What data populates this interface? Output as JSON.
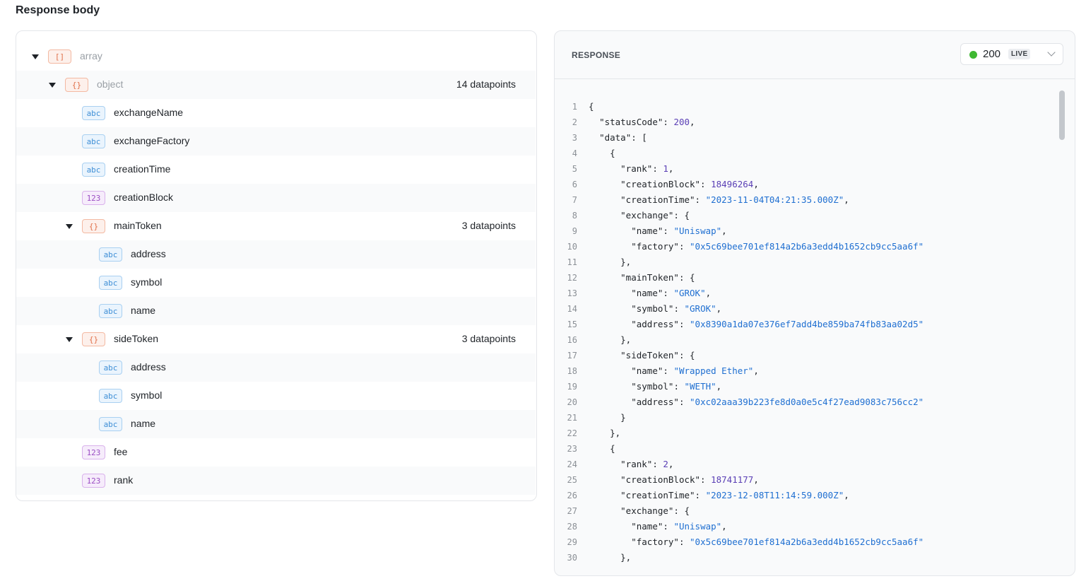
{
  "page": {
    "title": "Response body"
  },
  "schema": {
    "rows": [
      {
        "type": "array",
        "badge": "[]",
        "name": "array",
        "depth": 0,
        "caret": true,
        "count": ""
      },
      {
        "type": "object",
        "badge": "{}",
        "name": "object",
        "depth": 1,
        "caret": true,
        "count": "14 datapoints"
      },
      {
        "type": "string",
        "badge": "abc",
        "name": "exchangeName",
        "depth": 2,
        "caret": false,
        "count": ""
      },
      {
        "type": "string",
        "badge": "abc",
        "name": "exchangeFactory",
        "depth": 2,
        "caret": false,
        "count": ""
      },
      {
        "type": "string",
        "badge": "abc",
        "name": "creationTime",
        "depth": 2,
        "caret": false,
        "count": ""
      },
      {
        "type": "number",
        "badge": "123",
        "name": "creationBlock",
        "depth": 2,
        "caret": false,
        "count": ""
      },
      {
        "type": "object",
        "badge": "{}",
        "name": "mainToken",
        "depth": 2,
        "caret": true,
        "count": "3 datapoints"
      },
      {
        "type": "string",
        "badge": "abc",
        "name": "address",
        "depth": 3,
        "caret": false,
        "count": ""
      },
      {
        "type": "string",
        "badge": "abc",
        "name": "symbol",
        "depth": 3,
        "caret": false,
        "count": ""
      },
      {
        "type": "string",
        "badge": "abc",
        "name": "name",
        "depth": 3,
        "caret": false,
        "count": ""
      },
      {
        "type": "object",
        "badge": "{}",
        "name": "sideToken",
        "depth": 2,
        "caret": true,
        "count": "3 datapoints"
      },
      {
        "type": "string",
        "badge": "abc",
        "name": "address",
        "depth": 3,
        "caret": false,
        "count": ""
      },
      {
        "type": "string",
        "badge": "abc",
        "name": "symbol",
        "depth": 3,
        "caret": false,
        "count": ""
      },
      {
        "type": "string",
        "badge": "abc",
        "name": "name",
        "depth": 3,
        "caret": false,
        "count": ""
      },
      {
        "type": "number",
        "badge": "123",
        "name": "fee",
        "depth": 2,
        "caret": false,
        "count": ""
      },
      {
        "type": "number",
        "badge": "123",
        "name": "rank",
        "depth": 2,
        "caret": false,
        "count": ""
      }
    ]
  },
  "response": {
    "label": "RESPONSE",
    "status_code": "200",
    "status_tag": "LIVE",
    "status_color": "#3fb832",
    "lines": [
      [
        [
          "p",
          "{"
        ]
      ],
      [
        [
          "p",
          "  "
        ],
        [
          "k",
          "\"statusCode\""
        ],
        [
          "p",
          ": "
        ],
        [
          "n",
          "200"
        ],
        [
          "p",
          ","
        ]
      ],
      [
        [
          "p",
          "  "
        ],
        [
          "k",
          "\"data\""
        ],
        [
          "p",
          ": ["
        ]
      ],
      [
        [
          "p",
          "    {"
        ]
      ],
      [
        [
          "p",
          "      "
        ],
        [
          "k",
          "\"rank\""
        ],
        [
          "p",
          ": "
        ],
        [
          "n",
          "1"
        ],
        [
          "p",
          ","
        ]
      ],
      [
        [
          "p",
          "      "
        ],
        [
          "k",
          "\"creationBlock\""
        ],
        [
          "p",
          ": "
        ],
        [
          "n",
          "18496264"
        ],
        [
          "p",
          ","
        ]
      ],
      [
        [
          "p",
          "      "
        ],
        [
          "k",
          "\"creationTime\""
        ],
        [
          "p",
          ": "
        ],
        [
          "s",
          "\"2023-11-04T04:21:35.000Z\""
        ],
        [
          "p",
          ","
        ]
      ],
      [
        [
          "p",
          "      "
        ],
        [
          "k",
          "\"exchange\""
        ],
        [
          "p",
          ": {"
        ]
      ],
      [
        [
          "p",
          "        "
        ],
        [
          "k",
          "\"name\""
        ],
        [
          "p",
          ": "
        ],
        [
          "s",
          "\"Uniswap\""
        ],
        [
          "p",
          ","
        ]
      ],
      [
        [
          "p",
          "        "
        ],
        [
          "k",
          "\"factory\""
        ],
        [
          "p",
          ": "
        ],
        [
          "s",
          "\"0x5c69bee701ef814a2b6a3edd4b1652cb9cc5aa6f\""
        ]
      ],
      [
        [
          "p",
          "      },"
        ]
      ],
      [
        [
          "p",
          "      "
        ],
        [
          "k",
          "\"mainToken\""
        ],
        [
          "p",
          ": {"
        ]
      ],
      [
        [
          "p",
          "        "
        ],
        [
          "k",
          "\"name\""
        ],
        [
          "p",
          ": "
        ],
        [
          "s",
          "\"GROK\""
        ],
        [
          "p",
          ","
        ]
      ],
      [
        [
          "p",
          "        "
        ],
        [
          "k",
          "\"symbol\""
        ],
        [
          "p",
          ": "
        ],
        [
          "s",
          "\"GROK\""
        ],
        [
          "p",
          ","
        ]
      ],
      [
        [
          "p",
          "        "
        ],
        [
          "k",
          "\"address\""
        ],
        [
          "p",
          ": "
        ],
        [
          "s",
          "\"0x8390a1da07e376ef7add4be859ba74fb83aa02d5\""
        ]
      ],
      [
        [
          "p",
          "      },"
        ]
      ],
      [
        [
          "p",
          "      "
        ],
        [
          "k",
          "\"sideToken\""
        ],
        [
          "p",
          ": {"
        ]
      ],
      [
        [
          "p",
          "        "
        ],
        [
          "k",
          "\"name\""
        ],
        [
          "p",
          ": "
        ],
        [
          "s",
          "\"Wrapped Ether\""
        ],
        [
          "p",
          ","
        ]
      ],
      [
        [
          "p",
          "        "
        ],
        [
          "k",
          "\"symbol\""
        ],
        [
          "p",
          ": "
        ],
        [
          "s",
          "\"WETH\""
        ],
        [
          "p",
          ","
        ]
      ],
      [
        [
          "p",
          "        "
        ],
        [
          "k",
          "\"address\""
        ],
        [
          "p",
          ": "
        ],
        [
          "s",
          "\"0xc02aaa39b223fe8d0a0e5c4f27ead9083c756cc2\""
        ]
      ],
      [
        [
          "p",
          "      }"
        ]
      ],
      [
        [
          "p",
          "    },"
        ]
      ],
      [
        [
          "p",
          "    {"
        ]
      ],
      [
        [
          "p",
          "      "
        ],
        [
          "k",
          "\"rank\""
        ],
        [
          "p",
          ": "
        ],
        [
          "n",
          "2"
        ],
        [
          "p",
          ","
        ]
      ],
      [
        [
          "p",
          "      "
        ],
        [
          "k",
          "\"creationBlock\""
        ],
        [
          "p",
          ": "
        ],
        [
          "n",
          "18741177"
        ],
        [
          "p",
          ","
        ]
      ],
      [
        [
          "p",
          "      "
        ],
        [
          "k",
          "\"creationTime\""
        ],
        [
          "p",
          ": "
        ],
        [
          "s",
          "\"2023-12-08T11:14:59.000Z\""
        ],
        [
          "p",
          ","
        ]
      ],
      [
        [
          "p",
          "      "
        ],
        [
          "k",
          "\"exchange\""
        ],
        [
          "p",
          ": {"
        ]
      ],
      [
        [
          "p",
          "        "
        ],
        [
          "k",
          "\"name\""
        ],
        [
          "p",
          ": "
        ],
        [
          "s",
          "\"Uniswap\""
        ],
        [
          "p",
          ","
        ]
      ],
      [
        [
          "p",
          "        "
        ],
        [
          "k",
          "\"factory\""
        ],
        [
          "p",
          ": "
        ],
        [
          "s",
          "\"0x5c69bee701ef814a2b6a3edd4b1652cb9cc5aa6f\""
        ]
      ],
      [
        [
          "p",
          "      },"
        ]
      ]
    ]
  }
}
